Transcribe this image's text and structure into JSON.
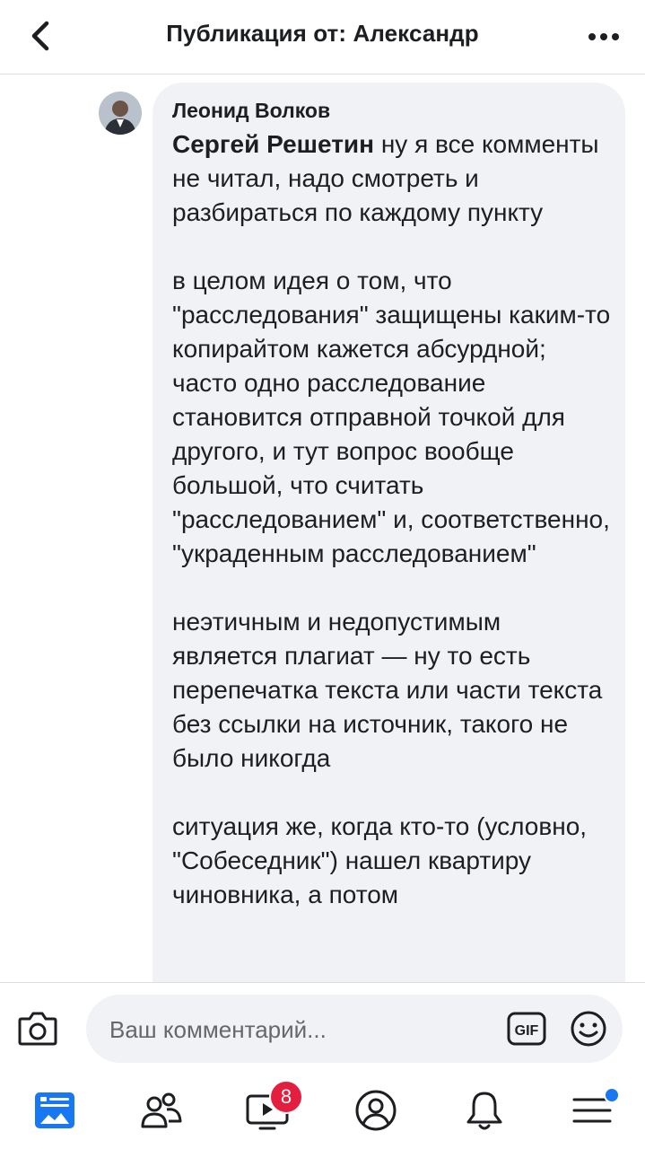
{
  "header": {
    "title": "Публикация от: Александр",
    "back_icon": "chevron-left-icon",
    "more_icon": "more-horizontal-icon"
  },
  "comment": {
    "author": "Леонид Волков",
    "mention": "Сергей Решетин",
    "paragraphs": [
      "ну я все комменты не читал, надо смотреть и разбираться по каждому пункту",
      "в целом идея о том, что \"расследования\" защищены каким-то копирайтом кажется абсурдной; часто одно расследование становится отправной точкой для другого, и тут вопрос вообще большой, что считать \"расследованием\" и, соответственно, \"украденным расследованием\"",
      "неэтичным и недопустимым является плагиат — ну то есть перепечатка текста или части текста без ссылки на источник, такого не было никогда",
      "ситуация же, когда кто-то (условно, \"Собеседник\") нашел квартиру чиновника, а потом"
    ]
  },
  "composer": {
    "placeholder": "Ваш комментарий...",
    "value": "",
    "gif_label": "GIF"
  },
  "nav": {
    "items": [
      {
        "name": "news-feed",
        "icon": "news-feed-icon",
        "active": true
      },
      {
        "name": "friends",
        "icon": "friends-icon",
        "active": false
      },
      {
        "name": "watch",
        "icon": "video-icon",
        "active": false,
        "badge": "8"
      },
      {
        "name": "profile",
        "icon": "profile-icon",
        "active": false
      },
      {
        "name": "notifications",
        "icon": "bell-icon",
        "active": false
      },
      {
        "name": "menu",
        "icon": "hamburger-menu-icon",
        "active": false,
        "dot": true
      }
    ],
    "watch_badge": "8"
  },
  "colors": {
    "accent": "#1877f2",
    "badge": "#e41e3f",
    "bubble": "#f0f2f5",
    "text": "#1c1e21",
    "icon": "#1c1e21"
  }
}
